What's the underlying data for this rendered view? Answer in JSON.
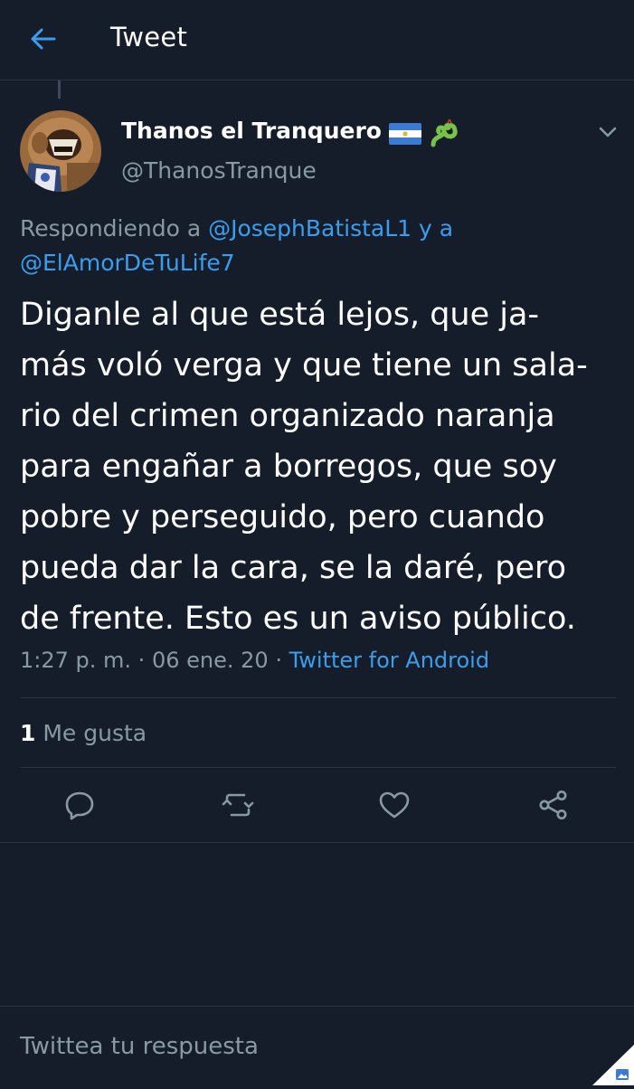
{
  "header": {
    "back_icon": "arrow-left-icon",
    "title": "Tweet"
  },
  "tweet": {
    "author": {
      "display_name": "Thanos el Tranquero",
      "handle": "@ThanosTranque",
      "emoji_icons": [
        "nicaragua-flag-icon",
        "snake-icon"
      ]
    },
    "reply_to": {
      "prefix": "Respondiendo a",
      "mention_1": "@JosephBatistaL1",
      "conjunction": "y a",
      "mention_2": "@ElAmorDeTuLife7"
    },
    "text_lines": [
      "Diganle al que está lejos, que ja-",
      "más voló verga y que tiene un sala-",
      "rio del crimen organizado naranja",
      "para engañar a borregos, que soy",
      "pobre y perseguido, pero cuando",
      "pueda dar la cara, se la daré, pero",
      "de frente. Esto es un aviso público."
    ],
    "time": "1:27 p. m.",
    "date": "06 ene. 20",
    "separator": "·",
    "source": "Twitter for Android",
    "likes_count": "1",
    "likes_label": "Me gusta"
  },
  "actions": [
    "reply-icon",
    "retweet-icon",
    "like-icon",
    "share-icon"
  ],
  "reply_bar": {
    "placeholder": "Twittea tu respuesta"
  },
  "colors": {
    "background": "#161d2a",
    "accent": "#3b9ded",
    "secondary_text": "#8899a6",
    "divider": "#2b3442"
  }
}
